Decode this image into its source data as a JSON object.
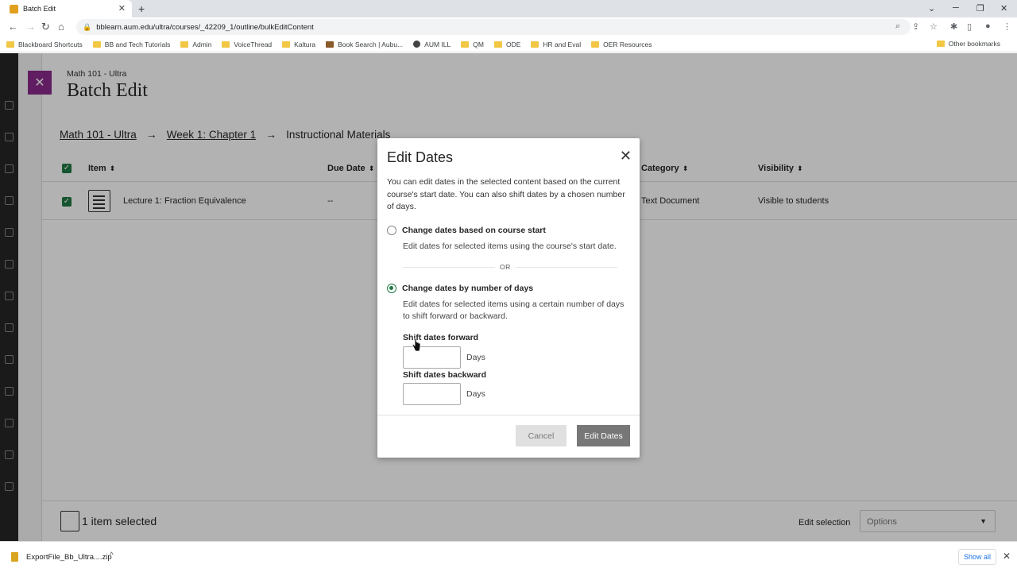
{
  "browser": {
    "tab_title": "Batch Edit",
    "url": "bblearn.aum.edu/ultra/courses/_42209_1/outline/bulkEditContent",
    "bookmarks": [
      "Blackboard Shortcuts",
      "BB and Tech Tutorials",
      "Admin",
      "VoiceThread",
      "Kaltura",
      "Book Search | Aubu...",
      "AUM ILL",
      "QM",
      "ODE",
      "HR and Eval",
      "OER Resources"
    ],
    "other_bookmarks": "Other bookmarks"
  },
  "page": {
    "course_name": "Math 101 - Ultra",
    "title": "Batch Edit",
    "breadcrumb": [
      "Math 101 - Ultra",
      "Week 1: Chapter 1",
      "Instructional Materials"
    ],
    "table": {
      "headers": [
        "Item",
        "Due Date",
        "Category",
        "Visibility"
      ],
      "row": {
        "name": "Lecture 1: Fraction Equivalence",
        "due": "--",
        "category": "Text Document",
        "visibility": "Visible to students"
      }
    },
    "footer": {
      "selected": "1 item selected",
      "edit_selection": "Edit selection",
      "options": "Options"
    }
  },
  "dialog": {
    "title": "Edit Dates",
    "intro": "You can edit dates in the selected content based on the current course's start date. You can also shift dates by a chosen number of days.",
    "option1_label": "Change dates based on course start",
    "option1_desc": "Edit dates for selected items using the course's start date.",
    "or_text": "OR",
    "option2_label": "Change dates by number of days",
    "option2_desc": "Edit dates for selected items using a certain number of days to shift forward or backward.",
    "forward_label": "Shift dates forward",
    "backward_label": "Shift dates backward",
    "days_unit": "Days",
    "cancel": "Cancel",
    "submit": "Edit Dates"
  },
  "download": {
    "filename": "ExportFile_Bb_Ultra....zip",
    "show_all": "Show all"
  },
  "colors": {
    "accent_green": "#1f7a45",
    "close_purple": "#8a2a8c"
  }
}
